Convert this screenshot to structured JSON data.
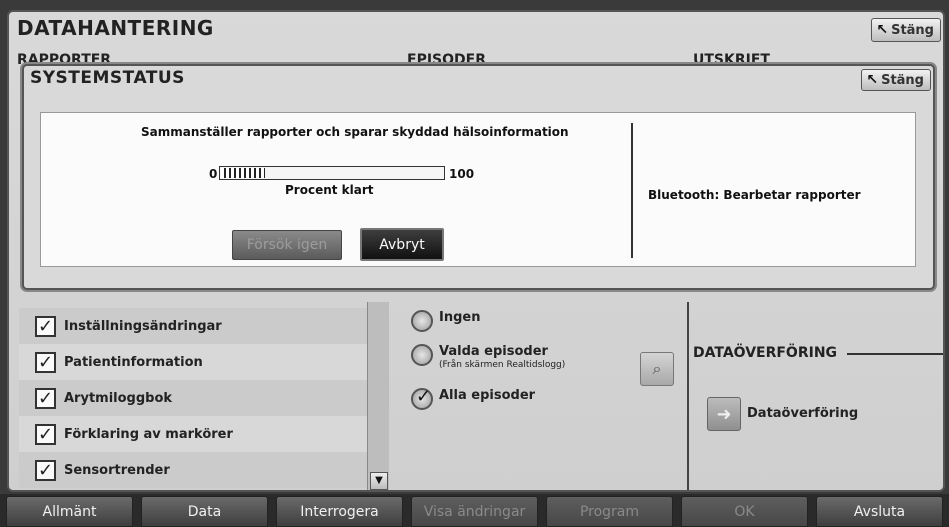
{
  "main": {
    "title": "DATAHANTERING",
    "close_label": "Stäng",
    "sections": {
      "reports": "RAPPORTER",
      "episodes": "EPISODER",
      "printout": "UTSKRIFT"
    },
    "checklist": [
      {
        "label": "Inställningsändringar",
        "checked": true
      },
      {
        "label": "Patientinformation",
        "checked": true
      },
      {
        "label": "Arytmiloggbok",
        "checked": true
      },
      {
        "label": "Förklaring av markörer",
        "checked": true
      },
      {
        "label": "Sensortrender",
        "checked": true
      }
    ],
    "episode_options": {
      "none": "Ingen",
      "selected": "Valda episoder",
      "selected_sub": "(Från skärmen Realtidslogg)",
      "all": "Alla episoder"
    },
    "data_transfer_section": "DATAÖVERFÖRING",
    "data_transfer_button": "Dataöverföring"
  },
  "dialog": {
    "title": "SYSTEMSTATUS",
    "close_label": "Stäng",
    "heading": "Sammanställer rapporter och sparar skyddad hälsoinformation",
    "progress_min": "0",
    "progress_max": "100",
    "progress_fraction": 0.2,
    "progress_label": "Procent klart",
    "retry_label": "Försök igen",
    "cancel_label": "Avbryt",
    "bluetooth_status": "Bluetooth: Bearbetar rapporter"
  },
  "bottom_nav": [
    {
      "label": "Allmänt",
      "enabled": true
    },
    {
      "label": "Data",
      "enabled": true
    },
    {
      "label": "Interrogera",
      "enabled": true
    },
    {
      "label": "Visa ändringar",
      "enabled": false
    },
    {
      "label": "Program",
      "enabled": false
    },
    {
      "label": "OK",
      "enabled": false
    },
    {
      "label": "Avsluta",
      "enabled": true
    }
  ]
}
